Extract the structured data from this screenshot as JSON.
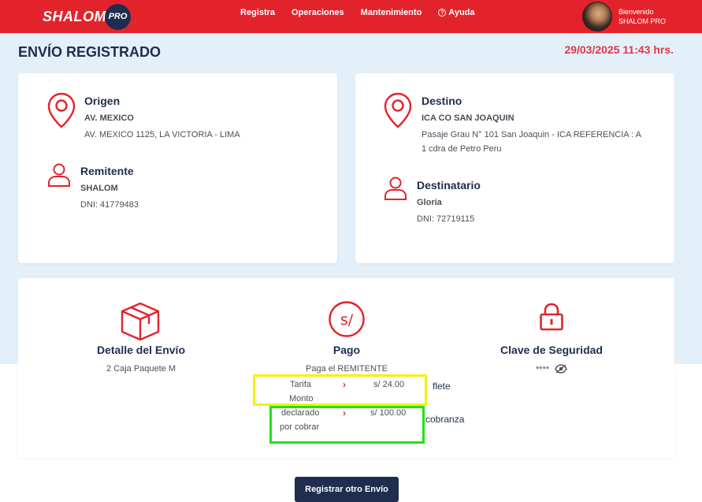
{
  "header": {
    "logo_text": "SHALOM",
    "logo_badge": "PRO",
    "nav": [
      "Registra",
      "Operaciones",
      "Mantenimiento",
      "Ayuda"
    ],
    "user_greeting": "Bienvenido",
    "user_name": "SHALOM PRO"
  },
  "page": {
    "title": "ENVÍO REGISTRADO",
    "datetime": "29/03/2025 11:43 hrs."
  },
  "origin": {
    "label": "Origen",
    "name": "AV. MEXICO",
    "address": "AV. MEXICO 1125, LA VICTORIA - LIMA"
  },
  "sender": {
    "label": "Remitente",
    "name": "SHALOM",
    "dni": "DNI: 41779483"
  },
  "destination": {
    "label": "Destino",
    "name": "ICA CO SAN JOAQUIN",
    "address_line1": "Pasaje Grau N° 101 San Joaquin - ICA REFERENCIA : A",
    "address_line2": "1 cdra de Petro Peru"
  },
  "recipient": {
    "label": "Destinatario",
    "name": "Gloria",
    "dni": "DNI: 72719115"
  },
  "detail": {
    "label": "Detalle del Envío",
    "value": "2 Caja Paquete M"
  },
  "payment": {
    "label": "Pago",
    "payer": "Paga el REMITENTE",
    "tarifa_label": "Tarifa",
    "tarifa_value": "s/ 24.00",
    "monto_label": "Monto",
    "declared_label": "declarado",
    "declared_value": "s/ 100.00",
    "por_cobrar_label": "por cobrar"
  },
  "security": {
    "label": "Clave de Seguridad",
    "value": "****"
  },
  "annotations": {
    "flete": "flete",
    "cobranza": "cobranza"
  },
  "actions": {
    "register_another": "Registrar otro Envío"
  },
  "colors": {
    "brand_red": "#e3232b",
    "navy": "#1f2d4e",
    "background": "#e3f0fa",
    "date_red": "#e3364a",
    "highlight_yellow": "#f2f20a",
    "highlight_green": "#22e01d"
  }
}
